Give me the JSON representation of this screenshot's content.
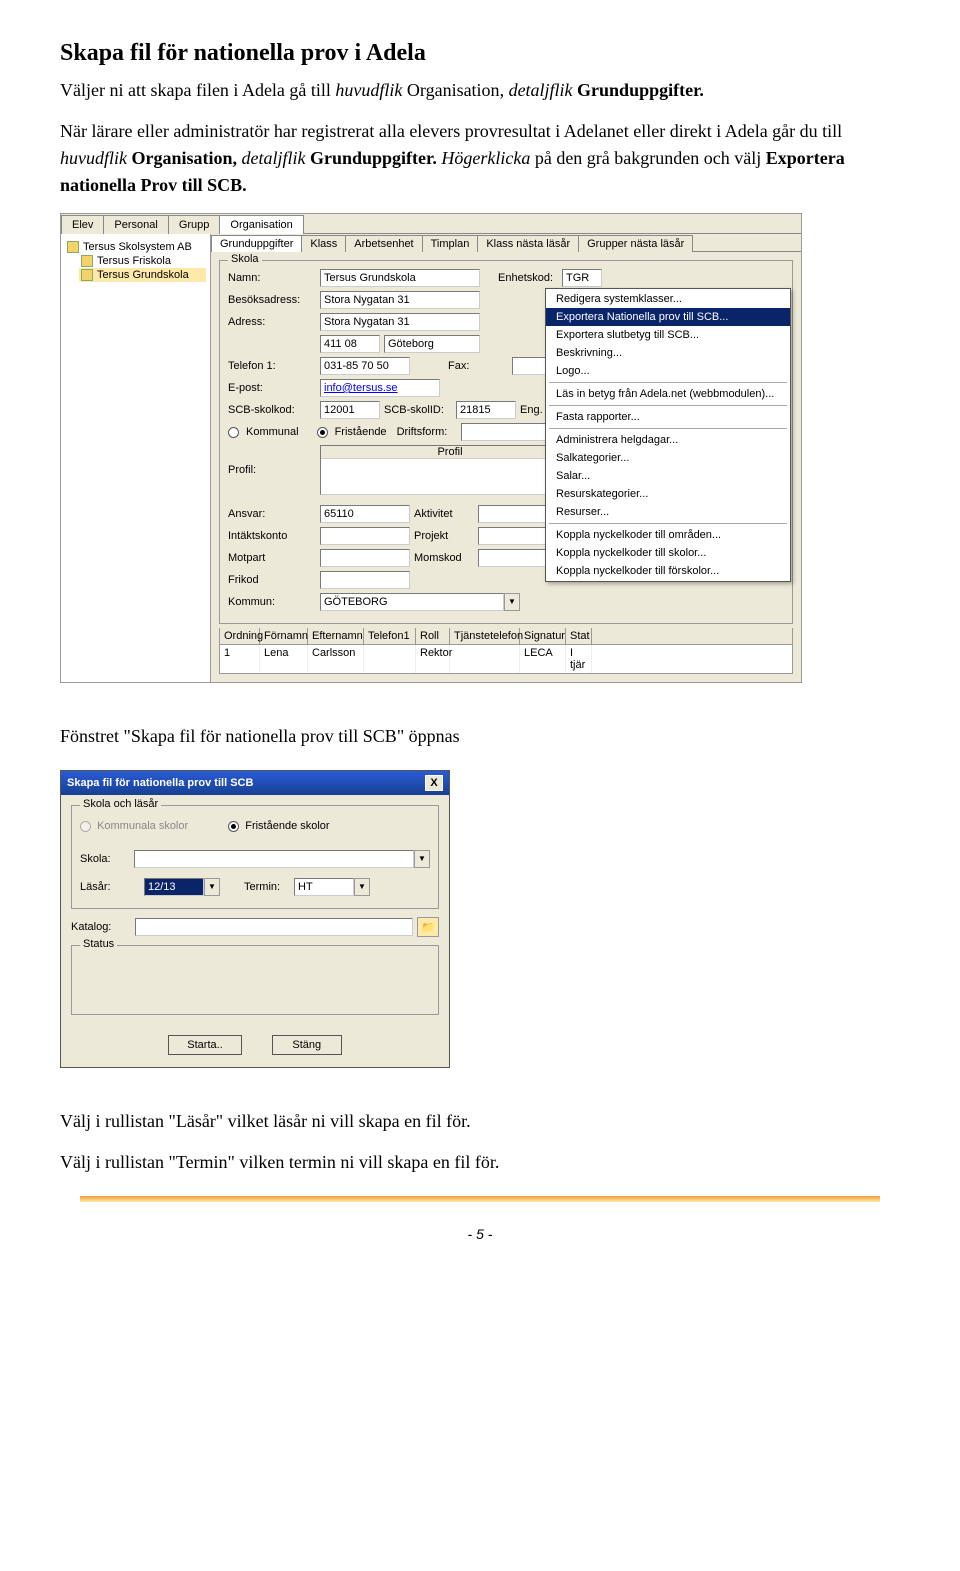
{
  "doc": {
    "h1": "Skapa fil för nationella prov i Adela",
    "p1_a": "Väljer ni att skapa filen i Adela gå till ",
    "p1_i1": "huvudflik",
    "p1_b1": " Organisation",
    "p1_c": ", ",
    "p1_i2": "detaljflik",
    "p1_b2": " Grunduppgifter.",
    "p2_a": "När lärare eller administratör har registrerat alla elevers provresultat i Adelanet eller direkt i Adela går du till ",
    "p2_i1": "huvudflik",
    "p2_b1": " Organisation, ",
    "p2_i2": "detaljflik",
    "p2_b2": " Grunduppgifter. ",
    "p2_i3": "Högerklicka",
    "p2_b3": " på den grå bakgrunden och välj ",
    "p2_bold": "Exportera nationella Prov till SCB.",
    "p3": "Fönstret \"Skapa fil för nationella prov till SCB\" öppnas",
    "p4": "Välj i rullistan \"Läsår\" vilket läsår ni vill skapa en fil för.",
    "p5": "Välj i rullistan \"Termin\" vilken termin ni vill skapa en fil för.",
    "pagenum": "- 5 -"
  },
  "app": {
    "tabs": [
      "Elev",
      "Personal",
      "Grupp",
      "Organisation"
    ],
    "tree": {
      "items": [
        "Tersus Skolsystem AB",
        "Tersus Friskola",
        "Tersus Grundskola"
      ]
    },
    "subtabs": [
      "Grunduppgifter",
      "Klass",
      "Arbetsenhet",
      "Timplan",
      "Klass nästa läsår",
      "Grupper nästa läsår"
    ],
    "school": {
      "group_title": "Skola",
      "namn_l": "Namn:",
      "namn_v": "Tersus Grundskola",
      "enhetskod_l": "Enhetskod:",
      "enhetskod_v": "TGR",
      "besok_l": "Besöksadress:",
      "besok_v": "Stora Nygatan 31",
      "adress_l": "Adress:",
      "adress_v": "Stora Nygatan 31",
      "postnr_v": "411 08",
      "ort_v": "Göteborg",
      "tel_l": "Telefon 1:",
      "tel_v": "031-85 70 50",
      "fax_l": "Fax:",
      "epost_l": "E-post:",
      "epost_v": "info@tersus.se",
      "scb_l": "SCB-skolkod:",
      "scb_v": "12001",
      "scbid_l": "SCB-skolID:",
      "scbid_v": "21815",
      "eng_l": "Eng. start:",
      "kommunal": "Kommunal",
      "fristaende": "Fristående",
      "driftsform_l": "Driftsform:",
      "profil_l": "Profil:",
      "profil_h": "Profil",
      "ansvar_l": "Ansvar:",
      "ansvar_v": "65110",
      "aktivitet_l": "Aktivitet",
      "intakt_l": "Intäktskonto",
      "projekt_l": "Projekt",
      "motpart_l": "Motpart",
      "momskod_l": "Momskod",
      "frikod_l": "Frikod",
      "kommun_l": "Kommun:",
      "kommun_v": "GÖTEBORG"
    },
    "context": {
      "items": [
        "Redigera systemklasser...",
        "Exportera Nationella prov till SCB...",
        "Exportera slutbetyg till SCB...",
        "Beskrivning...",
        "Logo...",
        "Läs in betyg från Adela.net (webbmodulen)...",
        "Fasta rapporter...",
        "Administrera helgdagar...",
        "Salkategorier...",
        "Salar...",
        "Resurskategorier...",
        "Resurser...",
        "Koppla nyckelkoder till områden...",
        "Koppla nyckelkoder till skolor...",
        "Koppla nyckelkoder till förskolor..."
      ]
    },
    "listhead": [
      "Ordning",
      "Förnamn",
      "Efternamn",
      "Telefon1",
      "Roll",
      "Tjänstetelefon",
      "Signatur",
      "Stat"
    ],
    "listrow": [
      "1",
      "Lena",
      "Carlsson",
      "",
      "Rektor",
      "",
      "LECA",
      "I tjär"
    ]
  },
  "dialog": {
    "title": "Skapa fil för nationella prov till SCB",
    "close": "X",
    "g1": "Skola och läsår",
    "kommunala": "Kommunala skolor",
    "fristaende": "Fristående skolor",
    "skola_l": "Skola:",
    "lasar_l": "Läsår:",
    "lasar_v": "12/13",
    "termin_l": "Termin:",
    "termin_v": "HT",
    "katalog_l": "Katalog:",
    "status_l": "Status",
    "starta": "Starta..",
    "stang": "Stäng"
  }
}
